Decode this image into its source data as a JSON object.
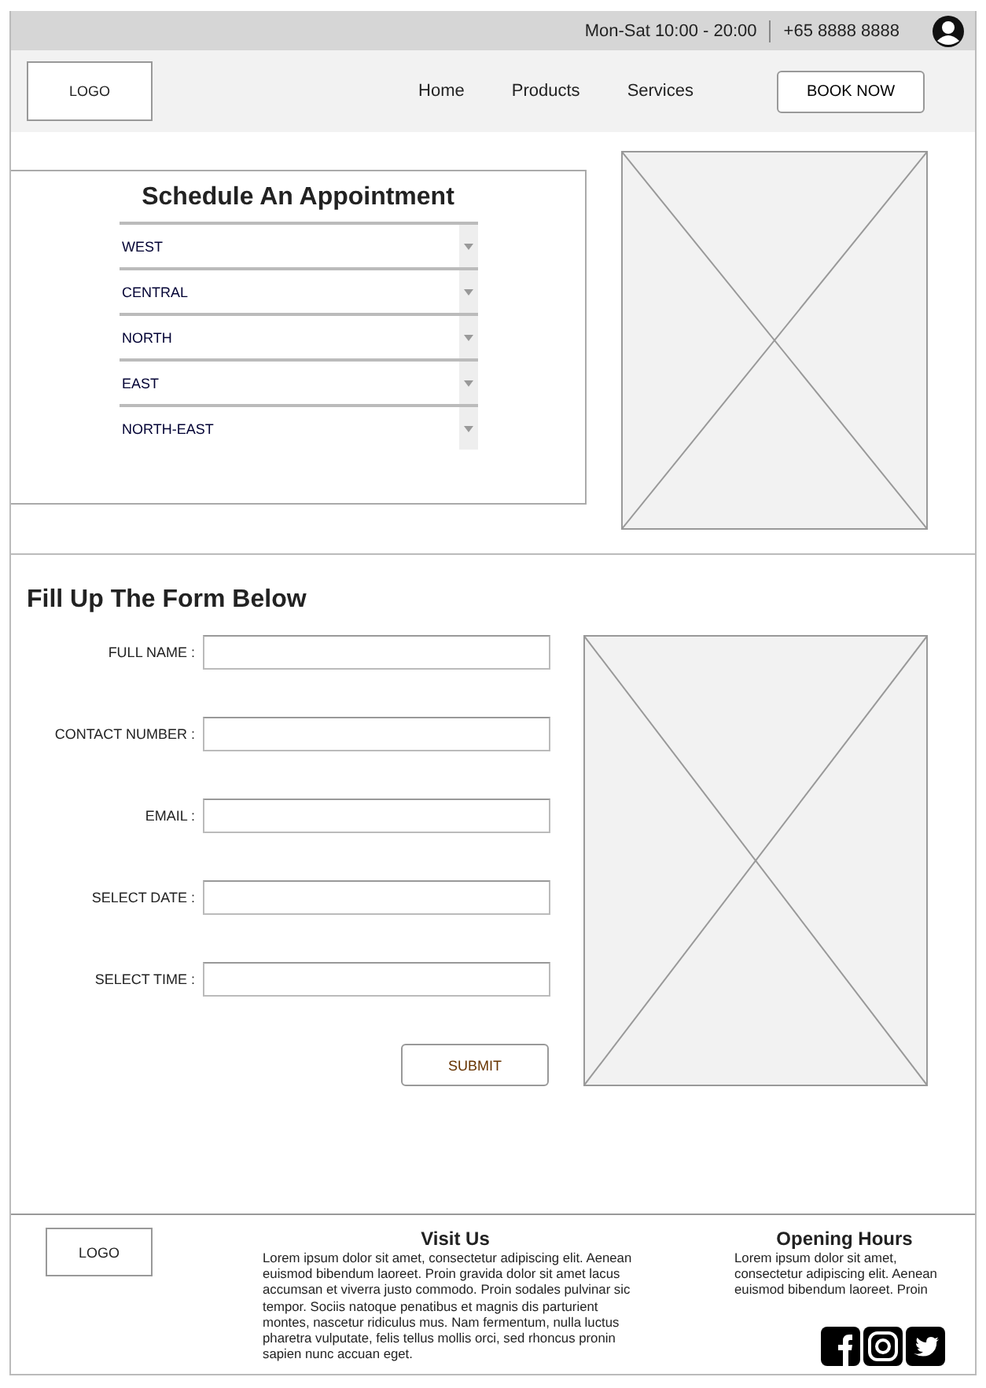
{
  "top_bar": {
    "hours": "Mon-Sat 10:00 - 20:00",
    "phone": "+65 8888 8888"
  },
  "nav": {
    "logo": "LOGO",
    "links": [
      "Home",
      "Products",
      "Services"
    ],
    "cta": "BOOK NOW"
  },
  "schedule": {
    "title": "Schedule An Appointment",
    "dropdowns": [
      "WEST",
      "CENTRAL",
      "NORTH",
      "EAST",
      "NORTH-EAST"
    ]
  },
  "form": {
    "title": "Fill Up The Form Below",
    "fields": [
      {
        "label": "FULL NAME :"
      },
      {
        "label": "CONTACT NUMBER :"
      },
      {
        "label": "EMAIL :"
      },
      {
        "label": "SELECT DATE :"
      },
      {
        "label": "SELECT TIME :"
      }
    ],
    "submit": "SUBMIT"
  },
  "footer": {
    "logo": "LOGO",
    "visit_title": "Visit Us",
    "visit_text": "Lorem ipsum dolor sit amet, consectetur adipiscing elit. Aenean euismod bibendum laoreet. Proin gravida dolor sit amet lacus accumsan et viverra justo commodo. Proin sodales pulvinar sic tempor. Sociis natoque penatibus et magnis dis parturient montes, nascetur ridiculus mus. Nam fermentum, nulla luctus pharetra vulputate, felis tellus mollis orci, sed rhoncus pronin sapien nunc accuan eget.",
    "hours_title": "Opening Hours",
    "hours_text": "Lorem ipsum dolor sit amet, consectetur adipiscing elit. Aenean euismod bibendum laoreet. Proin"
  }
}
